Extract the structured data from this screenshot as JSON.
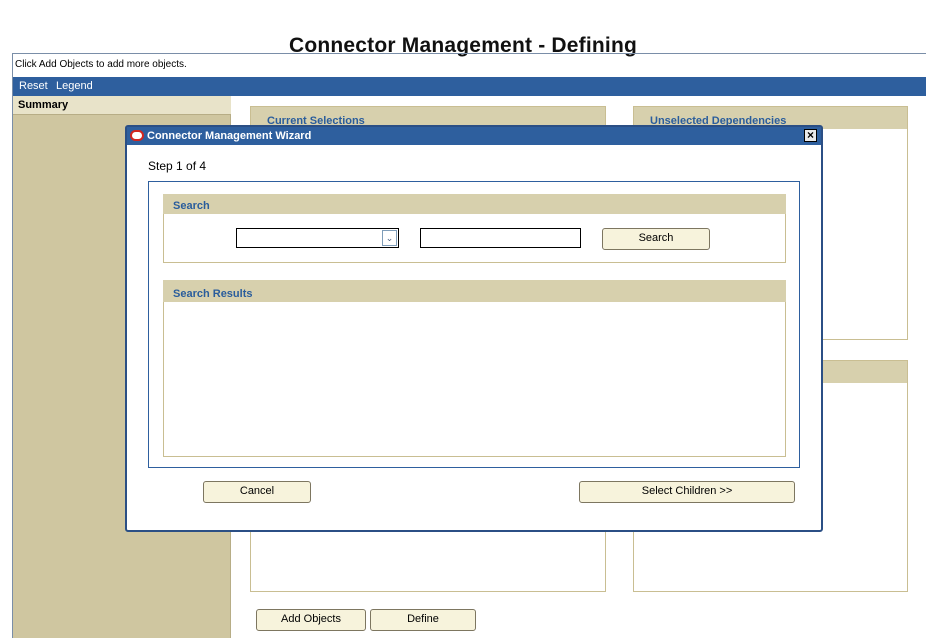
{
  "page": {
    "title": "Connector Management - Defining"
  },
  "hint": "Click Add Objects to add more objects.",
  "menu": [
    {
      "label": "Reset"
    },
    {
      "label": "Legend"
    }
  ],
  "sidebar": {
    "title": "Summary"
  },
  "panels": {
    "current_selections": "Current Selections",
    "unselected_dependencies": "Unselected Dependencies"
  },
  "footer": {
    "add_objects": "Add Objects",
    "define": "Define"
  },
  "modal": {
    "title": "Connector Management Wizard",
    "close": "×",
    "step": "Step 1 of 4",
    "search": {
      "title": "Search",
      "select_value": "",
      "input_value": "",
      "button": "Search"
    },
    "results": {
      "title": "Search Results"
    },
    "cancel": "Cancel",
    "select_children": "Select Children >>"
  },
  "icons": {
    "dropdown": "chevron-down-icon",
    "close": "close-icon",
    "logo": "oracle-logo-icon"
  },
  "colors": {
    "menu_bar": "#2e5f9e",
    "sidebar": "#cfc6a0",
    "section_header": "#d7d0ad",
    "section_title": "#2a5d9c"
  }
}
